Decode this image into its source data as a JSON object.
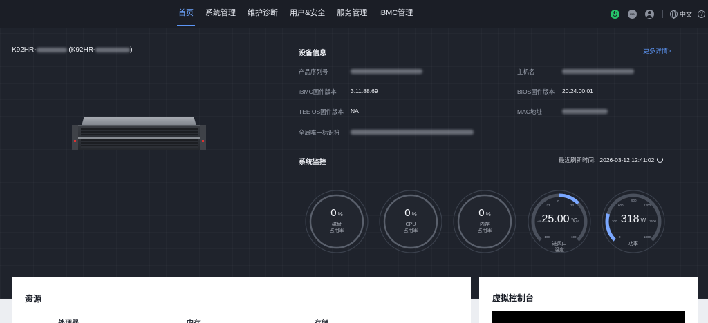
{
  "nav": {
    "tabs": [
      "首页",
      "系统管理",
      "维护诊断",
      "用户&安全",
      "服务管理",
      "iBMC管理"
    ],
    "active_index": 0,
    "uid_label": "UID",
    "language": "中文",
    "help_label": "?"
  },
  "device": {
    "name_prefix": "K92HR-",
    "name_middle": " (K92HR-",
    "name_suffix": ")"
  },
  "device_info": {
    "title": "设备信息",
    "more_link": "更多详情>",
    "fields": {
      "serial_label": "产品序列号",
      "hostname_label": "主机名",
      "ibmc_fw_label": "iBMC固件版本",
      "ibmc_fw_value": "3.11.88.69",
      "bios_fw_label": "BIOS固件版本",
      "bios_fw_value": "20.24.00.01",
      "tee_label": "TEE OS固件版本",
      "tee_value": "NA",
      "mac_label": "MAC地址",
      "guid_label": "全局唯一标识符"
    }
  },
  "monitor": {
    "title": "系统监控",
    "refresh_label": "最近刷新时间:",
    "refresh_time": "2026-03-12 12:41:02",
    "gauges": [
      {
        "value": "0",
        "unit": "%",
        "label1": "磁盘",
        "label2": "占用率"
      },
      {
        "value": "0",
        "unit": "%",
        "label1": "CPU",
        "label2": "占用率"
      },
      {
        "value": "0",
        "unit": "%",
        "label1": "内存",
        "label2": "占用率"
      }
    ],
    "temperature": {
      "value": "25.00",
      "unit": "℃",
      "label1": "进风口",
      "label2": "温度",
      "ticks": [
        "-33",
        "0",
        "33",
        "-66",
        "66",
        "-100",
        "100"
      ],
      "fill_fraction": 0.17
    },
    "power": {
      "value": "318",
      "unit": "W",
      "label1": "功率",
      "ticks": [
        "600",
        "900",
        "1200",
        "300",
        "1500",
        "0",
        "1800"
      ],
      "fill_fraction": 0.23
    }
  },
  "resources": {
    "title": "资源",
    "columns": [
      "处理器",
      "内存",
      "存储"
    ]
  },
  "console": {
    "title": "虚拟控制台"
  },
  "colors": {
    "accent": "#5c95f5",
    "power_on": "#26c46a",
    "gauge_fill": "#7aa7ff"
  }
}
